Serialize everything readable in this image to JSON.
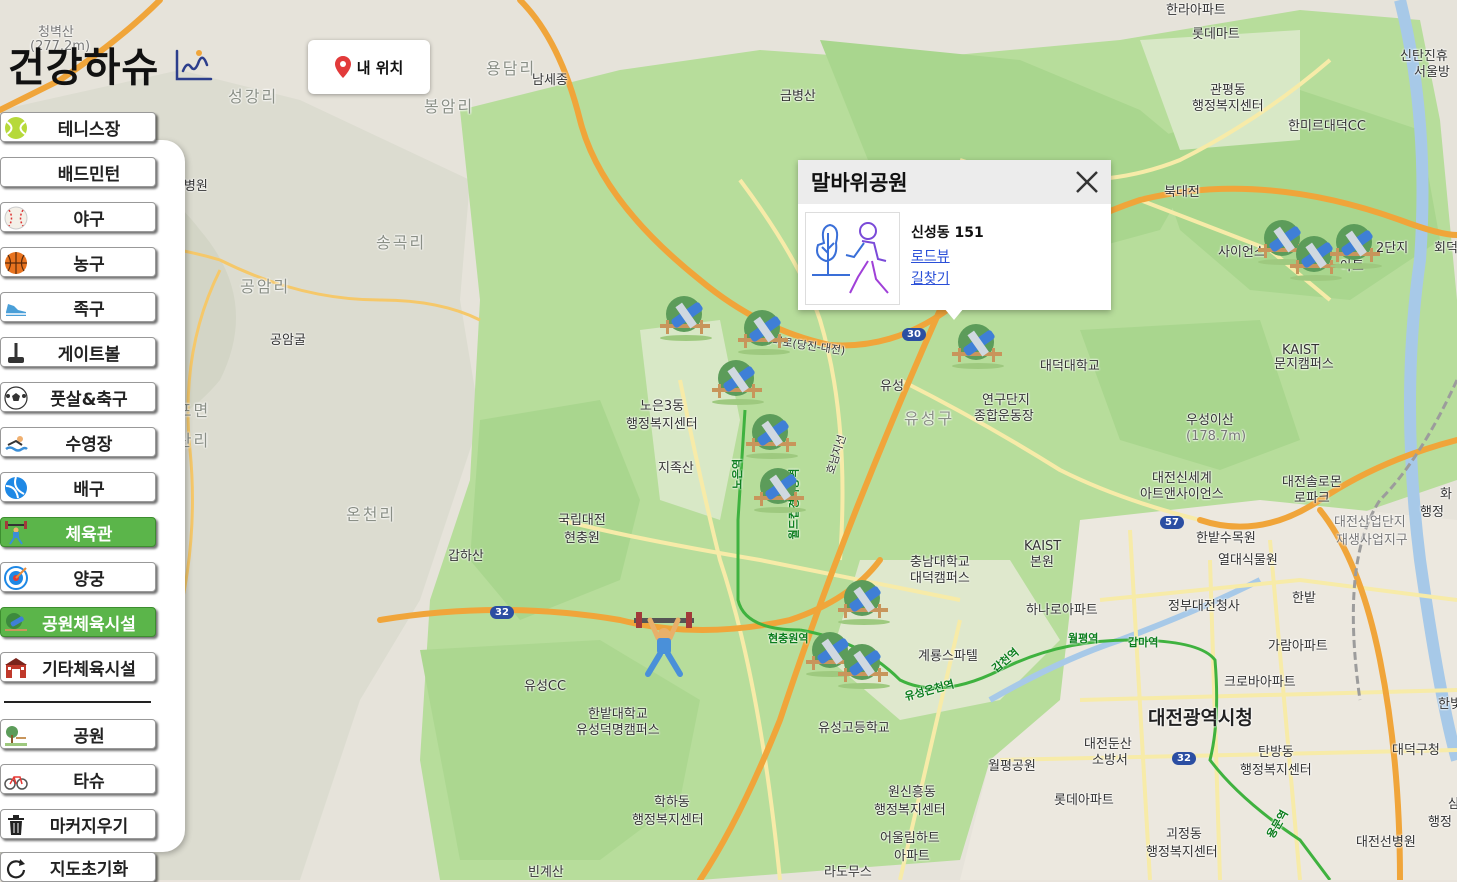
{
  "app": {
    "logo_text": "건강하슈",
    "my_location_label": "내 위치"
  },
  "sidebar": {
    "items": [
      {
        "label": "테니스장",
        "icon": "tennis-ball-icon",
        "active": false
      },
      {
        "label": "배드민턴",
        "icon": "",
        "active": false
      },
      {
        "label": "야구",
        "icon": "baseball-icon",
        "active": false
      },
      {
        "label": "농구",
        "icon": "basketball-icon",
        "active": false
      },
      {
        "label": "족구",
        "icon": "sneaker-icon",
        "active": false
      },
      {
        "label": "게이트볼",
        "icon": "gateball-stick-icon",
        "active": false
      },
      {
        "label": "풋살&축구",
        "icon": "soccer-ball-icon",
        "active": false
      },
      {
        "label": "수영장",
        "icon": "swimmer-icon",
        "active": false
      },
      {
        "label": "배구",
        "icon": "volleyball-icon",
        "active": false
      },
      {
        "label": "체육관",
        "icon": "weightlifter-icon",
        "active": true
      },
      {
        "label": "양궁",
        "icon": "archery-target-icon",
        "active": false
      },
      {
        "label": "공원체육시설",
        "icon": "park-equipment-icon",
        "active": true
      },
      {
        "label": "기타체육시설",
        "icon": "other-facility-icon",
        "active": false
      }
    ],
    "extra": [
      {
        "label": "공원",
        "icon": "park-icon"
      },
      {
        "label": "타슈",
        "icon": "bicycle-icon"
      },
      {
        "label": "마커지우기",
        "icon": "trash-icon"
      },
      {
        "label": "지도초기화",
        "icon": "refresh-icon"
      }
    ]
  },
  "popup": {
    "title": "말바위공원",
    "address": "신성동 151",
    "link_roadview": "로드뷰",
    "link_directions": "길찾기"
  },
  "map": {
    "labels": [
      {
        "text": "청벽산",
        "cls": "gray"
      },
      {
        "text": "(277.2m)",
        "cls": "gray"
      },
      {
        "text": "용담리",
        "cls": "faint"
      },
      {
        "text": "남세종",
        "cls": ""
      },
      {
        "text": "금병산",
        "cls": ""
      },
      {
        "text": "성강리",
        "cls": "faint"
      },
      {
        "text": "봉암리",
        "cls": "faint"
      },
      {
        "text": "송곡리",
        "cls": "faint"
      },
      {
        "text": "공암리",
        "cls": "faint"
      },
      {
        "text": "공암굴",
        "cls": ""
      },
      {
        "text": "법무병원",
        "cls": ""
      },
      {
        "text": "노은3동",
        "cls": ""
      },
      {
        "text": "행정복지센터",
        "cls": ""
      },
      {
        "text": "지족산",
        "cls": ""
      },
      {
        "text": "국립대전",
        "cls": ""
      },
      {
        "text": "현충원",
        "cls": ""
      },
      {
        "text": "갑하산",
        "cls": ""
      },
      {
        "text": "온천리",
        "cls": "faint"
      },
      {
        "text": "안산리",
        "cls": "faint"
      },
      {
        "text": "반포면",
        "cls": "faint"
      },
      {
        "text": "유성CC",
        "cls": ""
      },
      {
        "text": "한밭대학교",
        "cls": ""
      },
      {
        "text": "유성덕명캠퍼스",
        "cls": ""
      },
      {
        "text": "학하동",
        "cls": ""
      },
      {
        "text": "행정복지센터",
        "cls": ""
      },
      {
        "text": "빈계산",
        "cls": ""
      },
      {
        "text": "유성",
        "cls": ""
      },
      {
        "text": "유성구",
        "cls": "faint"
      },
      {
        "text": "대덕대학교",
        "cls": ""
      },
      {
        "text": "연구단지",
        "cls": ""
      },
      {
        "text": "종합운동장",
        "cls": ""
      },
      {
        "text": "충남대학교",
        "cls": ""
      },
      {
        "text": "대덕캠퍼스",
        "cls": ""
      },
      {
        "text": "KAIST",
        "cls": ""
      },
      {
        "text": "본원",
        "cls": ""
      },
      {
        "text": "하나로아파트",
        "cls": ""
      },
      {
        "text": "계룡스파텔",
        "cls": ""
      },
      {
        "text": "유성고등학교",
        "cls": ""
      },
      {
        "text": "원신흥동",
        "cls": ""
      },
      {
        "text": "행정복지센터",
        "cls": ""
      },
      {
        "text": "어울림하트",
        "cls": ""
      },
      {
        "text": "아파트",
        "cls": ""
      },
      {
        "text": "라도무스",
        "cls": ""
      },
      {
        "text": "월평공원",
        "cls": ""
      },
      {
        "text": "대전둔산",
        "cls": ""
      },
      {
        "text": "소방서",
        "cls": ""
      },
      {
        "text": "대전광역시청",
        "cls": "big"
      },
      {
        "text": "탄방동",
        "cls": ""
      },
      {
        "text": "행정복지센터",
        "cls": ""
      },
      {
        "text": "롯데아파트",
        "cls": ""
      },
      {
        "text": "괴정동",
        "cls": ""
      },
      {
        "text": "행정복지센터",
        "cls": ""
      },
      {
        "text": "대전선병원",
        "cls": ""
      },
      {
        "text": "대덕구청",
        "cls": ""
      },
      {
        "text": "정부대전청사",
        "cls": ""
      },
      {
        "text": "가람아파트",
        "cls": ""
      },
      {
        "text": "크로바아파트",
        "cls": ""
      },
      {
        "text": "한밭수목원",
        "cls": ""
      },
      {
        "text": "열대식물원",
        "cls": ""
      },
      {
        "text": "대전신세계",
        "cls": ""
      },
      {
        "text": "아트앤사이언스",
        "cls": ""
      },
      {
        "text": "대전솔로몬",
        "cls": ""
      },
      {
        "text": "로파크",
        "cls": ""
      },
      {
        "text": "대전산업단지",
        "cls": "gray"
      },
      {
        "text": "재생사업지구",
        "cls": "gray"
      },
      {
        "text": "우성이산",
        "cls": ""
      },
      {
        "text": "(178.7m)",
        "cls": "gray"
      },
      {
        "text": "KAIST",
        "cls": ""
      },
      {
        "text": "문지캠퍼스",
        "cls": ""
      },
      {
        "text": "사이언스",
        "cls": ""
      },
      {
        "text": "관평동",
        "cls": ""
      },
      {
        "text": "행정복지센터",
        "cls": ""
      },
      {
        "text": "한미르대덕CC",
        "cls": ""
      },
      {
        "text": "롯데마트",
        "cls": ""
      },
      {
        "text": "한라아파트",
        "cls": ""
      },
      {
        "text": "북대전",
        "cls": ""
      },
      {
        "text": "신탄진휴",
        "cls": ""
      },
      {
        "text": "서울방",
        "cls": ""
      },
      {
        "text": "한밭",
        "cls": ""
      },
      {
        "text": "회덕",
        "cls": ""
      },
      {
        "text": "화",
        "cls": ""
      },
      {
        "text": "행정",
        "cls": ""
      },
      {
        "text": "아트",
        "cls": ""
      },
      {
        "text": "2단지",
        "cls": ""
      },
      {
        "text": "한빛",
        "cls": ""
      },
      {
        "text": "삼",
        "cls": ""
      },
      {
        "text": "행정",
        "cls": ""
      }
    ],
    "stations": [
      "현충원역",
      "월드컵경기장역",
      "노은역",
      "유성온천역",
      "갑천역",
      "월평역",
      "갑마역",
      "용문역"
    ],
    "road_shields": [
      "32",
      "30",
      "57",
      "32"
    ],
    "road_names": [
      "유성대로(당진-대전)",
      "호남지선"
    ],
    "colors": {
      "land": "#b5dc98",
      "forest": "#a6d58b",
      "urban": "#ece8df",
      "highway": "#f2a23c",
      "road": "#f6e7a0",
      "subway": "#3fb23f"
    }
  }
}
